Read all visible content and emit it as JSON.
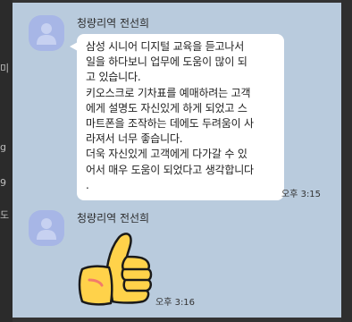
{
  "side_fragments": [
    "미",
    "g",
    "9",
    "도"
  ],
  "messages": [
    {
      "sender": "청량리역 전선희",
      "lines": [
        "삼성 시니어 디지털 교육을 듣고나서",
        "일을  하다보니 업무에 도움이 많이 되",
        "고 있습니다.",
        "키오스크로 기차표를 예매하려는 고객",
        "에게 설명도 자신있게 하게 되었고 스",
        "마트폰을 조작하는 데에도 두려움이 사",
        "라져서 너무 좋습니다.",
        "더욱 자신있게 고객에게 다가갈 수 있",
        "어서 매우 도움이 되었다고 생각합니다",
        "."
      ],
      "time": "오후 3:15"
    },
    {
      "sender": "청량리역 전선희",
      "sticker": "thumbs-up",
      "time": "오후 3:16"
    }
  ]
}
